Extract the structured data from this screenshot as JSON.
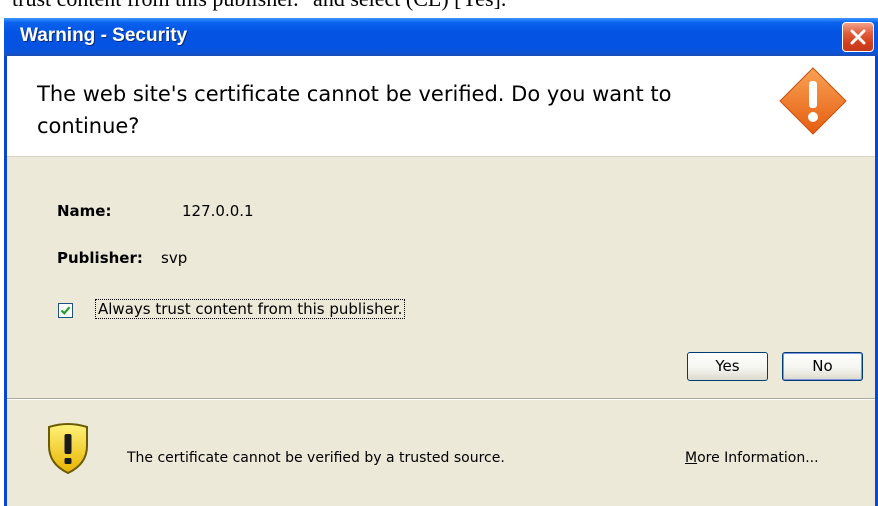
{
  "background_text": "trust content from this publisher.\" and select (CL) [Yes].",
  "window": {
    "title": "Warning - Security",
    "close_symbol": "✕"
  },
  "header": {
    "message": "The web site's certificate cannot be verified.  Do you want to continue?",
    "icon": "warning-diamond-icon",
    "icon_color": "#f26c1e"
  },
  "details": {
    "name_label": "Name:",
    "name_value": "127.0.0.1",
    "publisher_label": "Publisher:",
    "publisher_value": "svp"
  },
  "trust_checkbox": {
    "checked": true,
    "label": "Always trust content from this publisher."
  },
  "buttons": {
    "yes_label": "Yes",
    "no_label": "No"
  },
  "footer": {
    "icon": "shield-warning-icon",
    "message": "The certificate cannot be verified by a trusted source.",
    "more_info_first": "M",
    "more_info_rest": "ore Information..."
  },
  "colors": {
    "titlebar": "#0453e3",
    "dialog_body": "#ece9d8",
    "close_button": "#d2401e",
    "shield": "#f5d01c"
  }
}
